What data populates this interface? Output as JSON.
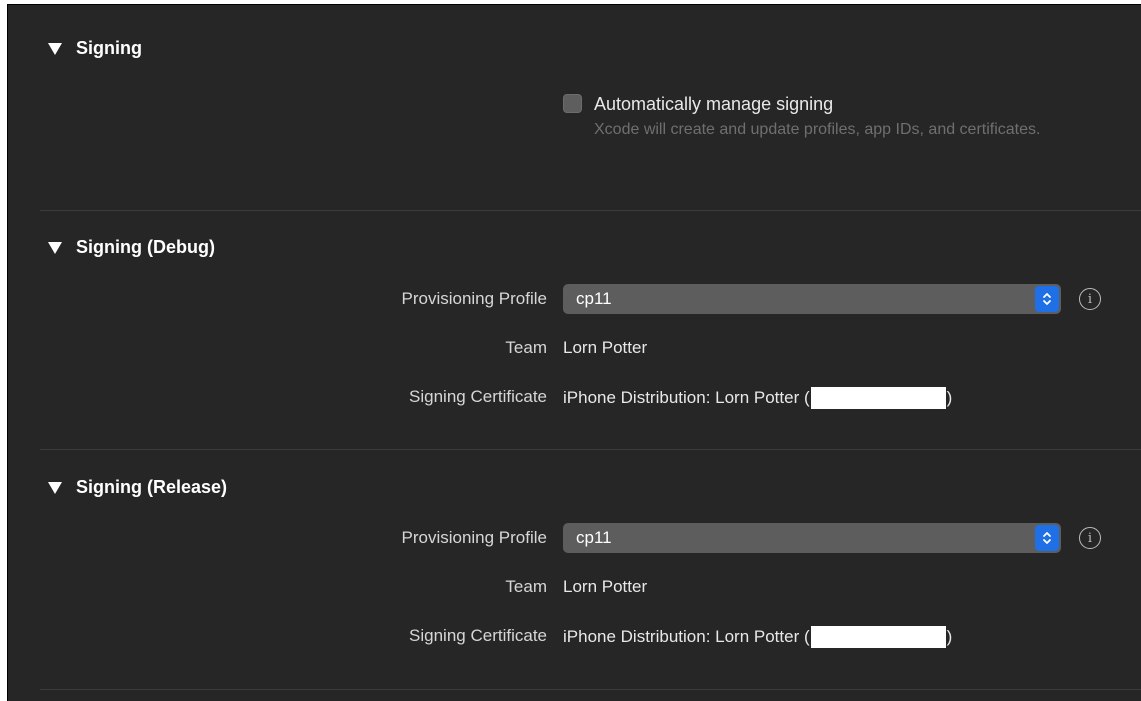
{
  "sections": {
    "signing": {
      "title": "Signing",
      "auto_manage": {
        "label": "Automatically manage signing",
        "checked": false,
        "description": "Xcode will create and update profiles, app IDs, and certificates."
      }
    },
    "debug": {
      "title": "Signing (Debug)",
      "provisioning_label": "Provisioning Profile",
      "provisioning_value": "cp11",
      "team_label": "Team",
      "team_value": "Lorn Potter",
      "certificate_label": "Signing Certificate",
      "certificate_prefix": "iPhone Distribution: Lorn Potter (",
      "certificate_suffix": ")"
    },
    "release": {
      "title": "Signing (Release)",
      "provisioning_label": "Provisioning Profile",
      "provisioning_value": "cp11",
      "team_label": "Team",
      "team_value": "Lorn Potter",
      "certificate_label": "Signing Certificate",
      "certificate_prefix": "iPhone Distribution: Lorn Potter (",
      "certificate_suffix": ")"
    }
  },
  "icons": {
    "disclosure": "disclosure-triangle-icon",
    "stepper": "chevron-up-down-icon",
    "info": "info-icon"
  },
  "colors": {
    "background": "#262626",
    "popup": "#5d5d5d",
    "accent": "#1f6fe6",
    "text": "#e8e8e8",
    "secondary_text": "#6f6f6f"
  }
}
